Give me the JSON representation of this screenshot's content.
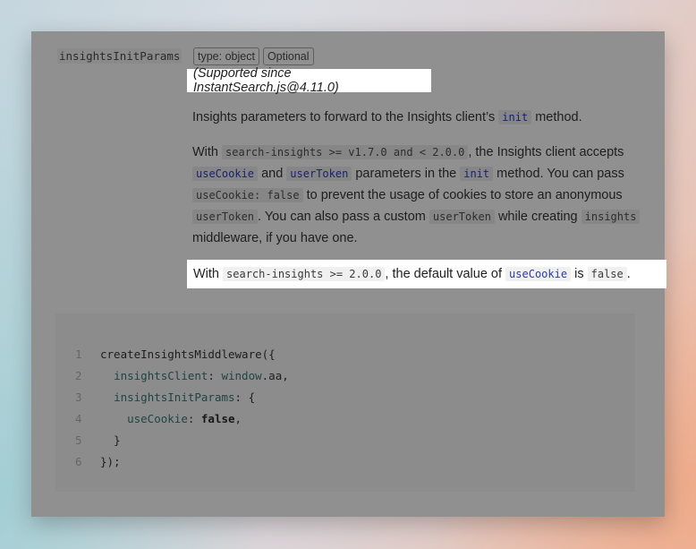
{
  "param": {
    "name": "insightsInitParams",
    "tags": [
      "type: object",
      "Optional"
    ],
    "since": "(Supported since InstantSearch.js@4.11.0)"
  },
  "description": {
    "p1": {
      "before": "Insights parameters to forward to the Insights client’s",
      "code": "init",
      "after": "method."
    },
    "p2": {
      "t1": "With",
      "c1": "search-insights >= v1.7.0 and < 2.0.0",
      "t2": ", the Insights client accepts",
      "c2": "useCookie",
      "t3": "and",
      "c3": "userToken",
      "t4": "parameters in the",
      "c4": "init",
      "t5": "method. You can pass",
      "c5": "useCookie: false",
      "t6": "to prevent the usage of cookies to store an anonymous",
      "c6": "userToken",
      "t7": ". You can also pass a custom",
      "c7": "userToken",
      "t8": "while creating",
      "c8": "insights",
      "t9": "middleware, if you have one."
    },
    "p3": {
      "t1": "With",
      "c1": "search-insights >= 2.0.0",
      "t2": ", the default value of",
      "c2": "useCookie",
      "t3": "is",
      "c3": "false",
      "t4": "."
    }
  },
  "code": {
    "line_numbers": [
      "1",
      "2",
      "3",
      "4",
      "5",
      "6"
    ],
    "l1": "createInsightsMiddleware({",
    "l2_key": "insightsClient",
    "l2_colon": ": ",
    "l2_obj": "window",
    "l2_rest": ".aa,",
    "l3_key": "insightsInitParams",
    "l3_rest": ": {",
    "l4_key": "useCookie",
    "l4_colon": ": ",
    "l4_val": "false",
    "l4_comma": ",",
    "l5": "}",
    "l6": "});"
  }
}
